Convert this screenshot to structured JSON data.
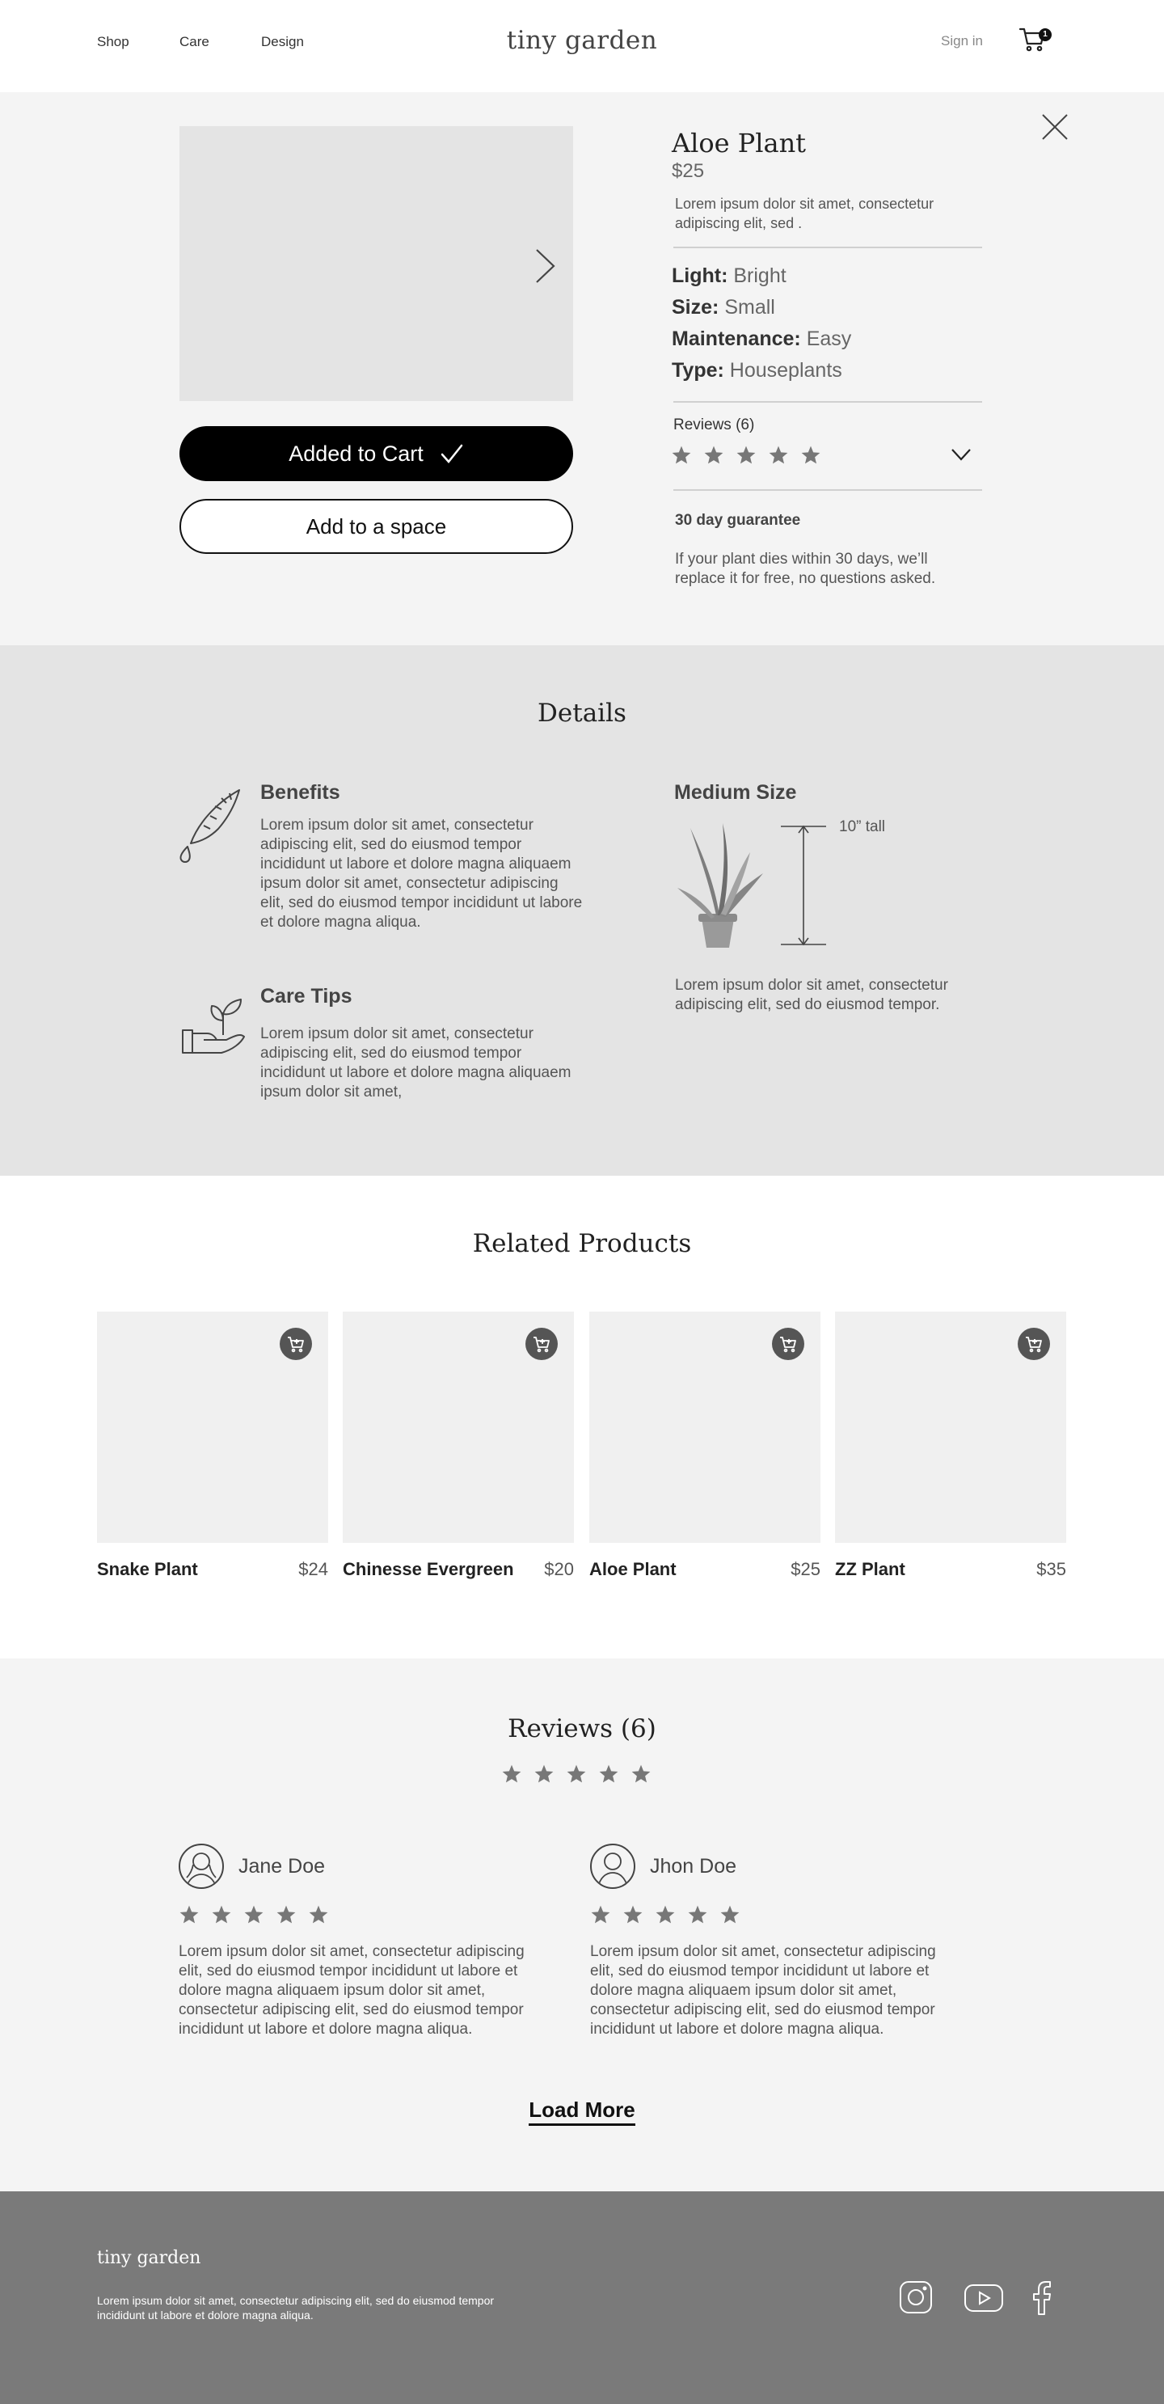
{
  "header": {
    "nav": [
      "Shop",
      "Care",
      "Design"
    ],
    "logo": "tiny garden",
    "signin": "Sign in",
    "cart_count": "1"
  },
  "product": {
    "name": "Aloe Plant",
    "price": "$25",
    "description": "Lorem ipsum dolor sit amet, consectetur adipiscing elit, sed .",
    "attributes": [
      {
        "label": "Light:",
        "value": "Bright"
      },
      {
        "label": "Size:",
        "value": "Small"
      },
      {
        "label": "Maintenance:",
        "value": "Easy"
      },
      {
        "label": "Type:",
        "value": "Houseplants"
      }
    ],
    "reviews_label": "Reviews (6)",
    "rating": 5,
    "added_to_cart": "Added to Cart",
    "add_to_space": "Add to a space",
    "guarantee_title": "30 day guarantee",
    "guarantee_text": "If your plant dies within 30 days, we’ll replace it for free, no questions asked."
  },
  "details": {
    "title": "Details",
    "benefits_title": "Benefits",
    "benefits_text": "Lorem ipsum dolor sit amet, consectetur adipiscing elit, sed do eiusmod tempor incididunt ut labore et dolore magna aliquaem ipsum dolor sit amet, consectetur adipiscing elit, sed do eiusmod tempor incididunt ut labore et dolore magna aliqua.",
    "care_title": "Care Tips",
    "care_text": "Lorem ipsum dolor sit amet, consectetur adipiscing elit, sed do eiusmod tempor incididunt ut labore et dolore magna aliquaem ipsum dolor sit amet,",
    "size_title": "Medium Size",
    "size_height": "10” tall",
    "size_text": "Lorem ipsum dolor sit amet, consectetur adipiscing elit, sed do eiusmod tempor."
  },
  "related": {
    "title": "Related Products",
    "items": [
      {
        "name": "Snake Plant",
        "price": "$24"
      },
      {
        "name": "Chinesse Evergreen",
        "price": "$20"
      },
      {
        "name": "Aloe Plant",
        "price": "$25"
      },
      {
        "name": "ZZ Plant",
        "price": "$35"
      }
    ]
  },
  "reviews": {
    "title": "Reviews (6)",
    "rating": 5,
    "items": [
      {
        "name": "Jane Doe",
        "rating": 5,
        "text": "Lorem ipsum dolor sit amet, consectetur adipiscing elit, sed do eiusmod tempor incididunt ut labore et dolore magna aliquaem ipsum dolor sit amet, consectetur adipiscing elit, sed do eiusmod tempor incididunt ut labore et dolore magna aliqua."
      },
      {
        "name": "Jhon Doe",
        "rating": 5,
        "text": "Lorem ipsum dolor sit amet, consectetur adipiscing elit, sed do eiusmod tempor incididunt ut labore et dolore magna aliquaem ipsum dolor sit amet, consectetur adipiscing elit, sed do eiusmod tempor incididunt ut labore et dolore magna aliqua."
      }
    ],
    "load_more": "Load More"
  },
  "footer": {
    "logo": "tiny garden",
    "text": "Lorem ipsum dolor sit amet, consectetur adipiscing elit, sed do eiusmod tempor incididunt ut labore et dolore magna aliqua.",
    "social": [
      "instagram-icon",
      "youtube-icon",
      "facebook-icon"
    ]
  },
  "colors": {
    "page_bg": "#ffffff",
    "section_bg": "#f4f4f4",
    "details_bg": "#e4e4e4",
    "footer_bg": "#7a7a7a",
    "primary_button": "#000000",
    "star": "#777777"
  }
}
